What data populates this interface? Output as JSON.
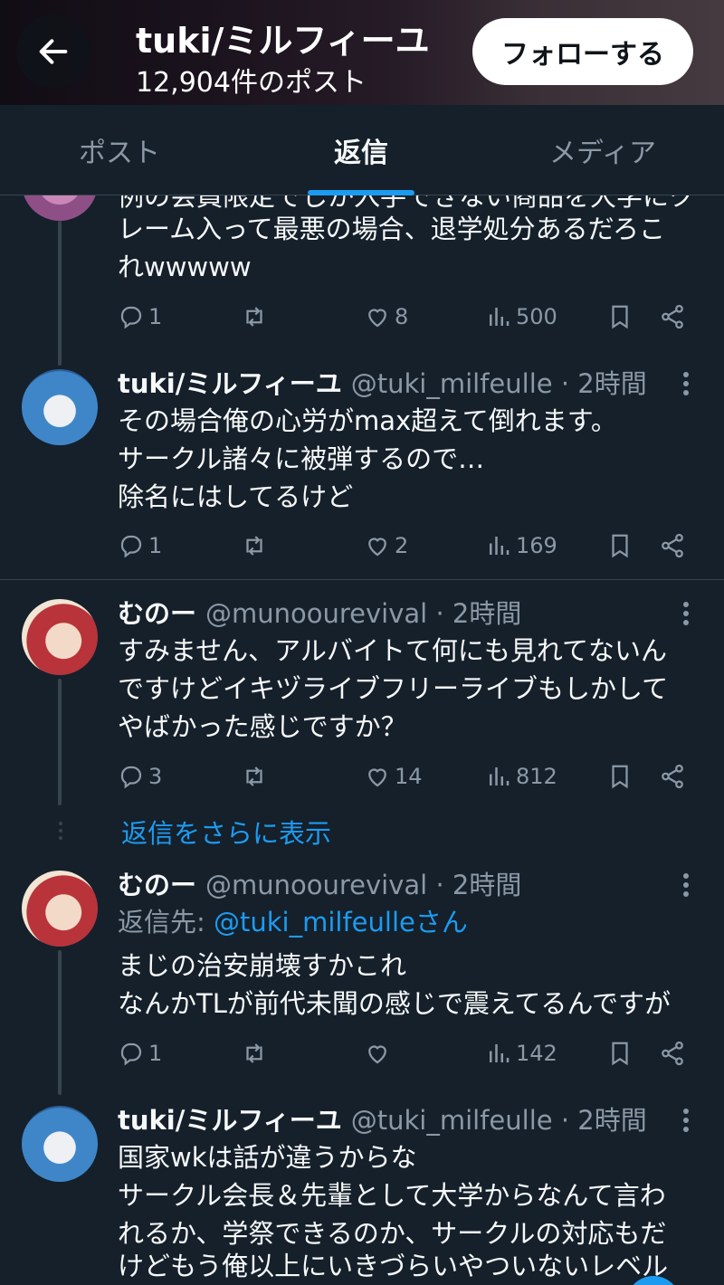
{
  "header": {
    "title": "tuki/ミルフィーユ",
    "post_count": "12,904件のポスト",
    "follow_label": "フォローする"
  },
  "tabs": [
    {
      "label": "ポスト",
      "active": false
    },
    {
      "label": "返信",
      "active": true
    },
    {
      "label": "メディア",
      "active": false
    }
  ],
  "posts": [
    {
      "partial": true,
      "text": [
        "例の会員限定でしか入手できない商品を大学にク",
        "レーム入って最悪の場合、退学処分あるだろこ",
        "れwwwww"
      ],
      "reply_count": "1",
      "like_count": "8",
      "view_count": "500"
    },
    {
      "author": "tuki/ミルフィーユ",
      "handle": "@tuki_milfeulle · 2時間",
      "text": [
        "その場合俺の心労がmax超えて倒れます。",
        "サークル諸々に被弾するので…",
        "除名にはしてるけど"
      ],
      "reply_count": "1",
      "like_count": "2",
      "view_count": "169"
    },
    {
      "author": "むのー",
      "handle": "@munoourevival · 2時間",
      "text": [
        "すみません、アルバイトて何にも見れてないん",
        "ですけどイキヅライブフリーライブもしかして",
        "やばかった感じですか？"
      ],
      "reply_count": "3",
      "like_count": "14",
      "view_count": "812"
    },
    {
      "author": "むのー",
      "handle": "@munoourevival · 2時間",
      "reply_to_prefix": "返信先: ",
      "reply_to_mention": "@tuki_milfeulleさん",
      "text": [
        "まじの治安崩壊すかこれ",
        "なんかTLが前代未聞の感じで震えてるんですが"
      ],
      "reply_count": "1",
      "like_count": "",
      "view_count": "142"
    },
    {
      "author": "tuki/ミルフィーユ",
      "handle": "@tuki_milfeulle · 2時間",
      "text": [
        "国家wkは話が違うからな",
        "サークル会長＆先輩として大学からなんて言わ",
        "れるか、学祭できるのか、サークルの対応もだ",
        "けどもう俺以上にいきづらいやついないレベル"
      ]
    }
  ],
  "show_more_replies": "返信をさらに表示",
  "icons": {
    "back": "arrow-left-icon",
    "reply": "reply-icon",
    "repost": "repost-icon",
    "like": "heart-icon",
    "views": "views-icon",
    "bookmark": "bookmark-icon",
    "share": "share-icon",
    "more": "more-vertical-icon"
  },
  "colors": {
    "background": "#15202b",
    "accent": "#1d9bf0",
    "secondary_text": "#8b98a5",
    "border": "#38444d"
  }
}
